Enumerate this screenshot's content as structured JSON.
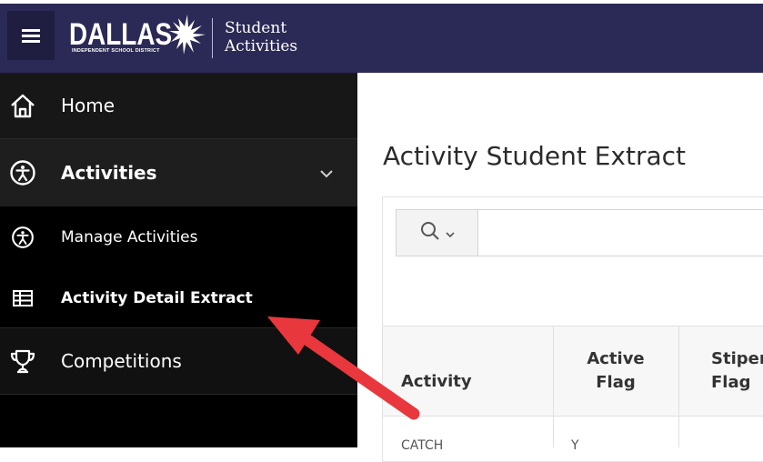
{
  "header": {
    "logo_main": "DALLAS",
    "logo_sub": "INDEPENDENT SCHOOL DISTRICT",
    "app_title": "Student\nActivities"
  },
  "sidebar": {
    "items": [
      {
        "label": "Home",
        "icon": "home-icon"
      },
      {
        "label": "Activities",
        "icon": "accessibility-icon",
        "expanded": true
      },
      {
        "label": "Manage Activities",
        "icon": "accessibility-icon"
      },
      {
        "label": "Activity Detail Extract",
        "icon": "table-icon"
      },
      {
        "label": "Competitions",
        "icon": "trophy-icon"
      }
    ]
  },
  "main": {
    "page_title": "Activity Student Extract",
    "table": {
      "columns": [
        "Activity",
        "Active\nFlag",
        "Stipen\nFlag"
      ],
      "first_row_fragments": [
        "CATCH",
        "Y"
      ]
    }
  },
  "colors": {
    "header_bg": "#2b2955",
    "sidebar_bg": "#000000",
    "arrow": "#e8383d"
  }
}
